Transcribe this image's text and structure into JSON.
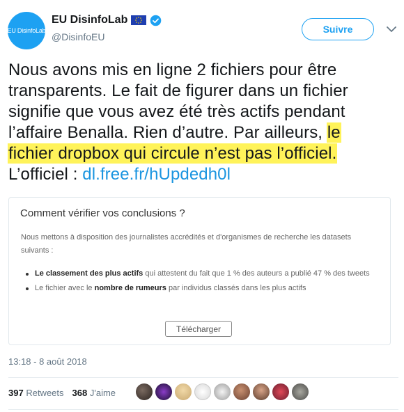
{
  "author": {
    "display_name": "EU DisinfoLab",
    "handle": "@DisinfoEU",
    "avatar_text": "EU DisinfoLab",
    "flag_icon": "eu-flag-icon",
    "verified_icon": "verified-badge-icon"
  },
  "follow_label": "Suivre",
  "tweet": {
    "lines": [
      "Nous avons mis en ligne 2 fichiers pour être",
      "transparents. Le fait de figurer dans un fichier",
      "signifie que vous avez été très actifs pendant",
      "l’affaire Benalla. Rien d’autre. Par ailleurs,"
    ],
    "highlight_part1": "le",
    "highlight_line": "fichier dropbox qui circule n’est pas l’officiel.",
    "last_prefix": "L’officiel : ",
    "link": "dl.free.fr/hUpdedh0l"
  },
  "card": {
    "title": "Comment vérifier vos conclusions ?",
    "intro": "Nous mettons à disposition des journalistes accrédités et d'organismes de recherche les datasets suivants :",
    "bullet1_bold": "Le classement des plus actifs",
    "bullet1_rest": " qui attestent du fait que 1 % des auteurs a publié 47 % des tweets",
    "bullet2_prefix": "Le fichier avec le ",
    "bullet2_bold": "nombre de rumeurs",
    "bullet2_rest": " par individus classés dans les plus actifs",
    "button": "Télécharger"
  },
  "timestamp": "13:18 - 8 août 2018",
  "stats": {
    "retweets_count": "397",
    "retweets_label": "Retweets",
    "likes_count": "368",
    "likes_label": "J'aime"
  },
  "colors": {
    "brand_blue": "#1da1f2",
    "link_blue": "#1b95e0",
    "highlight": "#fff35a"
  }
}
